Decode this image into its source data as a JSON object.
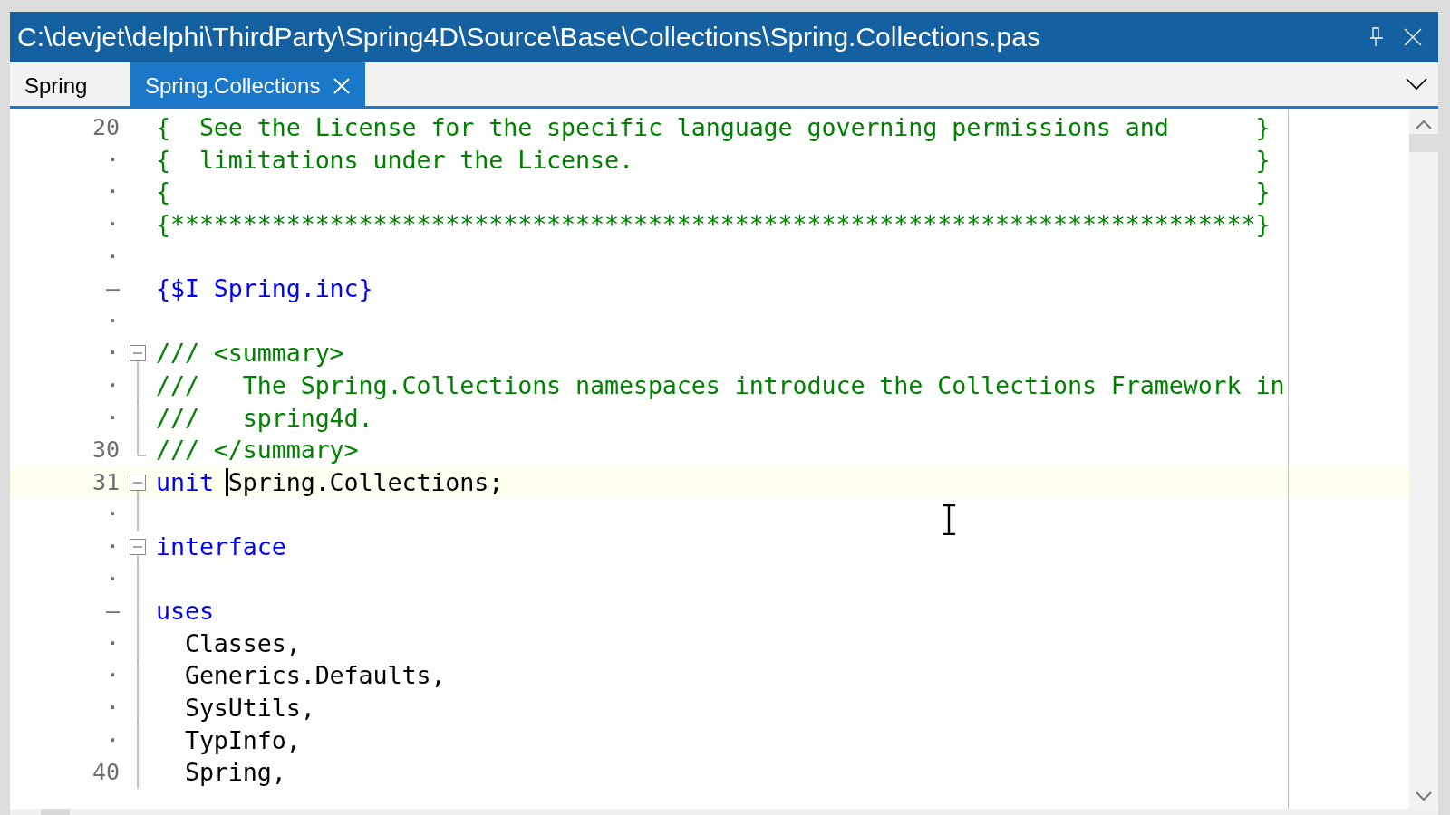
{
  "window": {
    "title": "C:\\devjet\\delphi\\ThirdParty\\Spring4D\\Source\\Base\\Collections\\Spring.Collections.pas"
  },
  "tabs": [
    {
      "label": "Spring",
      "selected": false
    },
    {
      "label": "Spring.Collections",
      "selected": true
    }
  ],
  "lines": [
    {
      "gutter": "20",
      "current": false,
      "segments": [
        {
          "kind": "comment",
          "text": "{  See the License for the specific language governing permissions and      }",
          "caret": false
        }
      ]
    },
    {
      "gutter": "·",
      "current": false,
      "segments": [
        {
          "kind": "comment",
          "text": "{  limitations under the License.                                           }",
          "caret": false
        }
      ]
    },
    {
      "gutter": "·",
      "current": false,
      "segments": [
        {
          "kind": "comment",
          "text": "{                                                                           }",
          "caret": false
        }
      ]
    },
    {
      "gutter": "·",
      "current": false,
      "segments": [
        {
          "kind": "comment",
          "text": "{***************************************************************************}",
          "caret": false
        }
      ]
    },
    {
      "gutter": "·",
      "current": false
    },
    {
      "gutter": "–",
      "current": false,
      "segments": [
        {
          "kind": "directive",
          "text": "{$I Spring.inc}",
          "caret": false
        }
      ]
    },
    {
      "gutter": "·",
      "current": false
    },
    {
      "gutter": "·",
      "fold": {
        "kind": "box"
      },
      "current": false,
      "segments": [
        {
          "kind": "comment",
          "text": "/// <summary>",
          "caret": false
        }
      ]
    },
    {
      "gutter": "·",
      "fold": {
        "kind": "line"
      },
      "current": false,
      "segments": [
        {
          "kind": "comment",
          "text": "///   The Spring.Collections namespaces introduce the Collections Framework in",
          "caret": false
        }
      ]
    },
    {
      "gutter": "·",
      "fold": {
        "kind": "line"
      },
      "current": false,
      "segments": [
        {
          "kind": "comment",
          "text": "///   spring4d.",
          "caret": false
        }
      ]
    },
    {
      "gutter": "30",
      "fold": {
        "kind": "end"
      },
      "current": false,
      "segments": [
        {
          "kind": "comment",
          "text": "/// </summary>",
          "caret": false
        }
      ]
    },
    {
      "gutter": "31",
      "fold": {
        "kind": "box"
      },
      "current": true,
      "segments": [
        {
          "kind": "keyword",
          "text": "unit ",
          "caret": false
        },
        {
          "kind": "plain",
          "text": "Spring.Collections;",
          "caret": true
        }
      ]
    },
    {
      "gutter": "·",
      "fold": {
        "kind": "line"
      },
      "current": false
    },
    {
      "gutter": "·",
      "fold": {
        "kind": "box"
      },
      "current": false,
      "segments": [
        {
          "kind": "keyword",
          "text": "interface",
          "caret": false
        }
      ]
    },
    {
      "gutter": "·",
      "fold": {
        "kind": "line"
      },
      "current": false
    },
    {
      "gutter": "–",
      "fold": {
        "kind": "line"
      },
      "current": false,
      "segments": [
        {
          "kind": "keyword",
          "text": "uses",
          "caret": false
        }
      ]
    },
    {
      "gutter": "·",
      "fold": {
        "kind": "line"
      },
      "current": false,
      "segments": [
        {
          "kind": "plain",
          "text": "  Classes,",
          "caret": false
        }
      ]
    },
    {
      "gutter": "·",
      "fold": {
        "kind": "line"
      },
      "current": false,
      "segments": [
        {
          "kind": "plain",
          "text": "  Generics.Defaults,",
          "caret": false
        }
      ]
    },
    {
      "gutter": "·",
      "fold": {
        "kind": "line"
      },
      "current": false,
      "segments": [
        {
          "kind": "plain",
          "text": "  SysUtils,",
          "caret": false
        }
      ]
    },
    {
      "gutter": "·",
      "fold": {
        "kind": "line"
      },
      "current": false,
      "segments": [
        {
          "kind": "plain",
          "text": "  TypInfo,",
          "caret": false
        }
      ]
    },
    {
      "gutter": "40",
      "fold": {
        "kind": "line"
      },
      "current": false,
      "segments": [
        {
          "kind": "plain",
          "text": "  Spring,",
          "caret": false
        }
      ]
    }
  ]
}
